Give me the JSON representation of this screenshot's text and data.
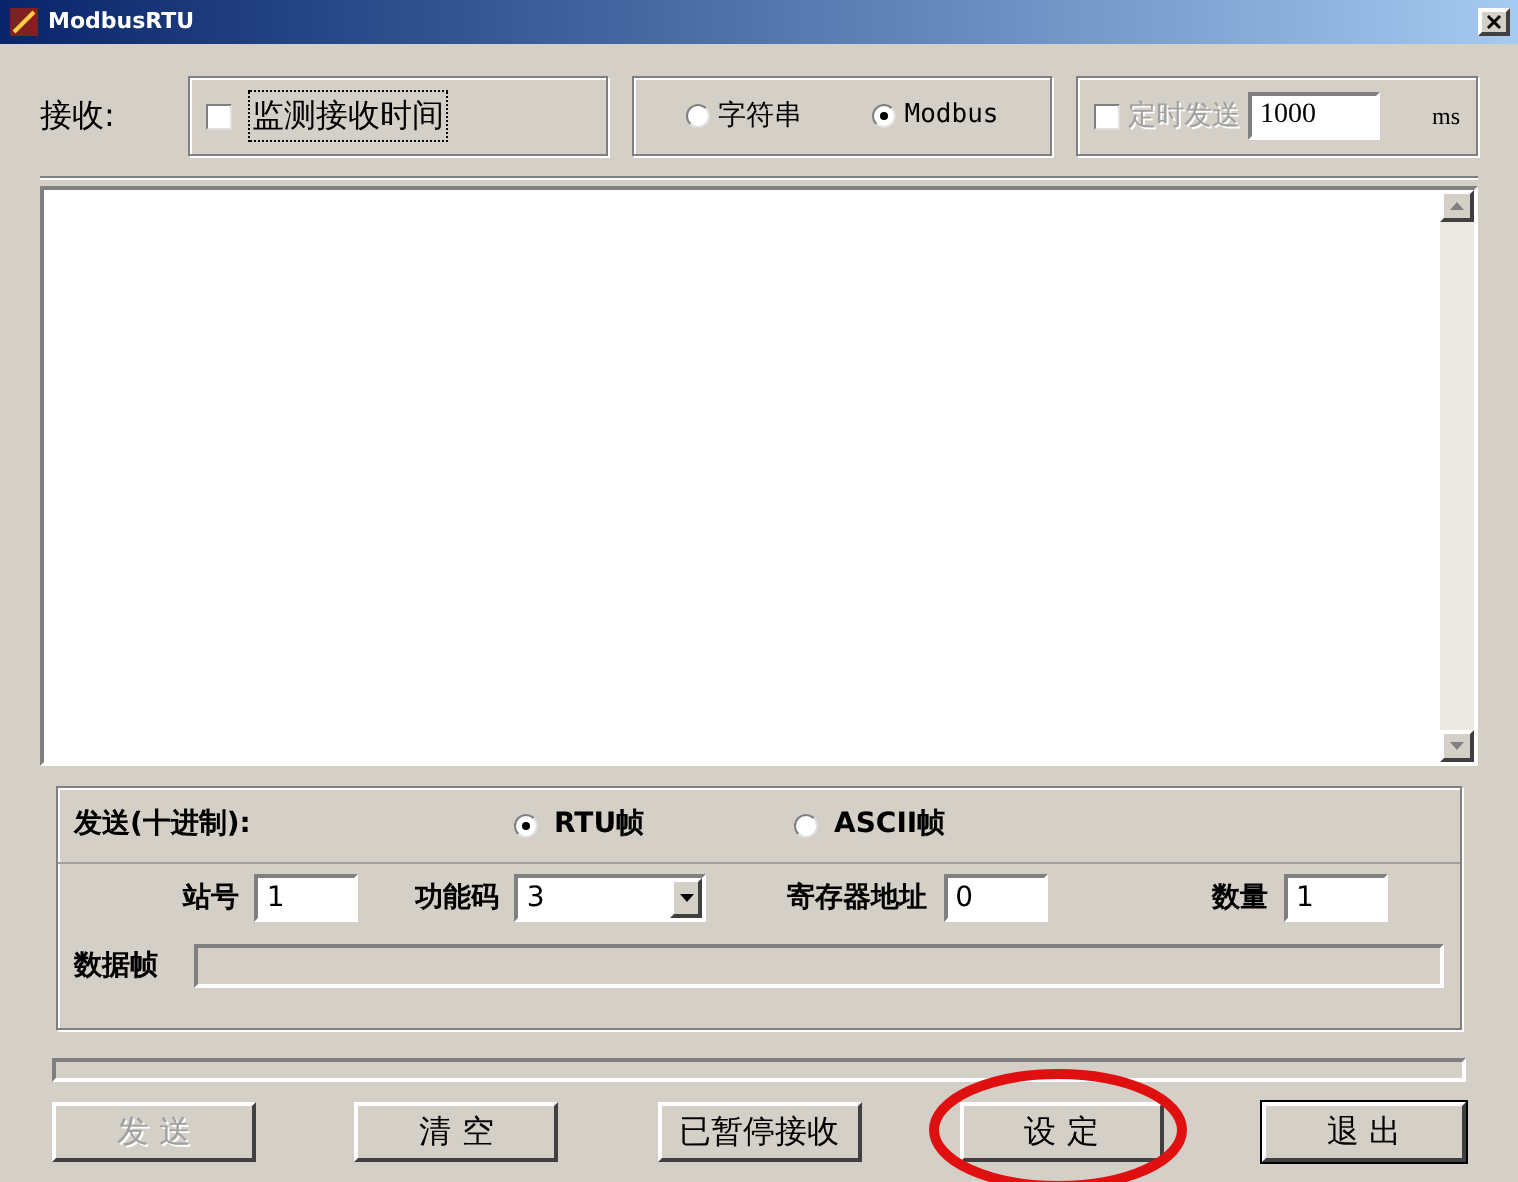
{
  "window": {
    "title": "ModbusRTU"
  },
  "receive": {
    "label": "接收:",
    "monitor": {
      "label": "监测接收时间",
      "checked": false
    },
    "modes": [
      {
        "label": "字符串",
        "selected": false
      },
      {
        "label": "Modbus",
        "selected": true
      }
    ],
    "timed_send": {
      "label": "定时发送",
      "checked": false,
      "disabled": true,
      "value": "1000",
      "unit": "ms"
    }
  },
  "send": {
    "label": "发送(十进制):",
    "frame_types": [
      {
        "label": "RTU帧",
        "selected": true
      },
      {
        "label": "ASCII帧",
        "selected": false
      }
    ],
    "fields": [
      {
        "kind": "input",
        "label": "站号",
        "value": "1"
      },
      {
        "kind": "dropdown",
        "label": "功能码",
        "value": "3"
      },
      {
        "kind": "input",
        "label": "寄存器地址",
        "value": "0"
      },
      {
        "kind": "input",
        "label": "数量",
        "value": "1"
      }
    ],
    "data_frame": {
      "label": "数据帧"
    }
  },
  "progress": {
    "level": 0
  },
  "buttons": [
    {
      "label": "发 送",
      "disabled": true,
      "default": false
    },
    {
      "label": "清 空",
      "disabled": false,
      "default": false
    },
    {
      "label": "已暂停接收",
      "disabled": false,
      "default": false
    },
    {
      "label": "设 定",
      "disabled": false,
      "default": false
    },
    {
      "label": "退 出",
      "disabled": false,
      "default": true
    }
  ],
  "annotation": {
    "kind": "circle",
    "color": "#e01010"
  }
}
